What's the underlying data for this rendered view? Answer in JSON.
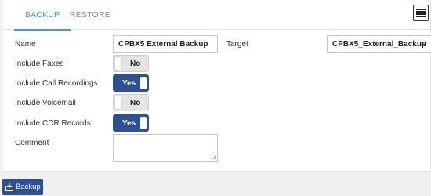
{
  "tabs": {
    "backup": "BACKUP",
    "restore": "RESTORE"
  },
  "form": {
    "name_label": "Name",
    "name_value": "CPBX5 External Backup",
    "target_label": "Target",
    "target_value": "CPBX5_External_Backup",
    "faxes_label": "Include Faxes",
    "faxes_state": "No",
    "recordings_label": "Include Call Recordings",
    "recordings_state": "Yes",
    "voicemail_label": "Include Voicemail",
    "voicemail_state": "No",
    "cdr_label": "Include CDR Records",
    "cdr_state": "Yes",
    "comment_label": "Comment",
    "comment_value": ""
  },
  "footer": {
    "backup_button": "Backup"
  },
  "icons": {
    "menu": "list-icon",
    "select": "chevron-down-icon",
    "backup": "backup-icon"
  },
  "colors": {
    "accent": "#3aa6b9",
    "toggle_on": "#2c4f95",
    "primary_button": "#2c4f95"
  }
}
